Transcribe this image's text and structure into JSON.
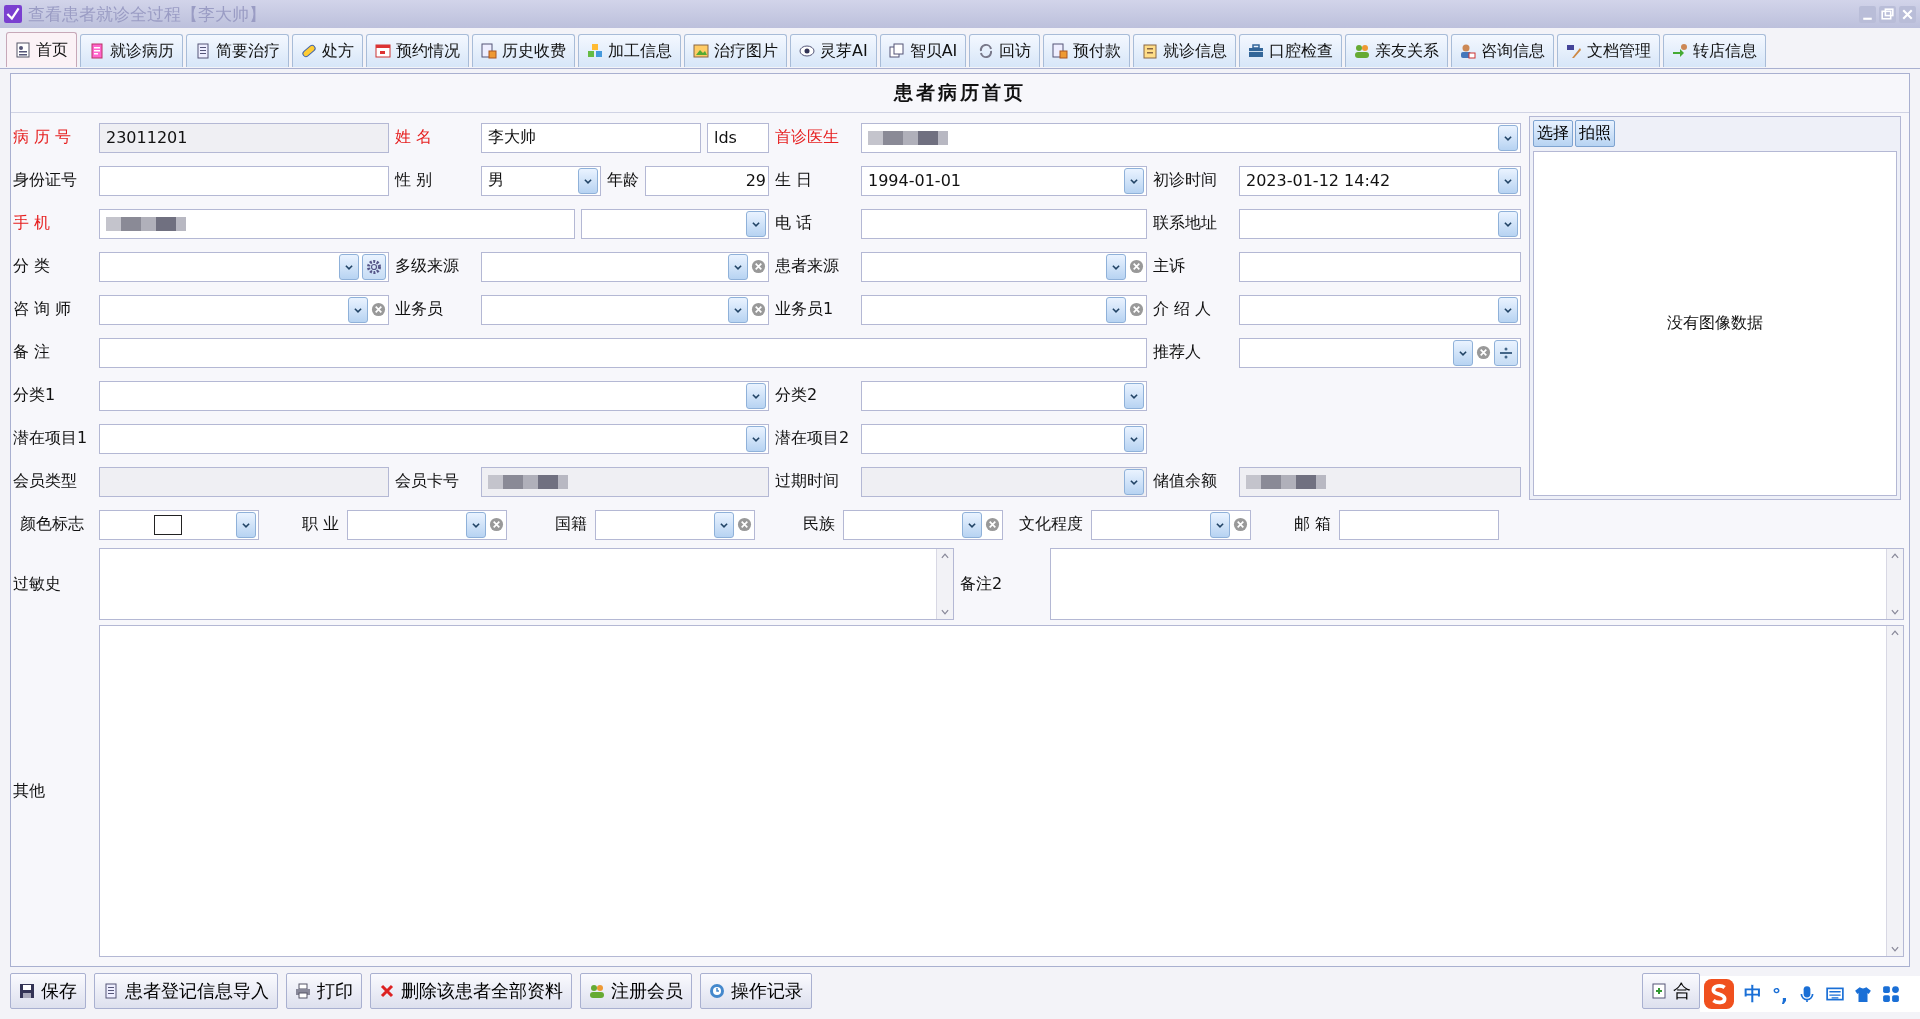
{
  "window": {
    "title": "查看患者就诊全过程【李大帅】"
  },
  "tabs": [
    {
      "label": "首页",
      "selected": true
    },
    {
      "label": "就诊病历",
      "selected": false
    },
    {
      "label": "简要治疗",
      "selected": false
    },
    {
      "label": "处方",
      "selected": false
    },
    {
      "label": "预约情况",
      "selected": false
    },
    {
      "label": "历史收费",
      "selected": false
    },
    {
      "label": "加工信息",
      "selected": false
    },
    {
      "label": "治疗图片",
      "selected": false
    },
    {
      "label": "灵芽AI",
      "selected": false
    },
    {
      "label": "智贝AI",
      "selected": false
    },
    {
      "label": "回访",
      "selected": false
    },
    {
      "label": "预付款",
      "selected": false
    },
    {
      "label": "就诊信息",
      "selected": false
    },
    {
      "label": "口腔检查",
      "selected": false
    },
    {
      "label": "亲友关系",
      "selected": false
    },
    {
      "label": "咨询信息",
      "selected": false
    },
    {
      "label": "文档管理",
      "selected": false
    },
    {
      "label": "转店信息",
      "selected": false
    }
  ],
  "form": {
    "title": "患者病历首页",
    "rows": [
      {
        "fields": [
          {
            "label": "病 历 号",
            "required": true,
            "inputs": [
              {
                "kind": "text",
                "value": "23011201",
                "disabled": true
              }
            ]
          },
          {
            "label": "姓 名",
            "required": true,
            "inputs": [
              {
                "kind": "text",
                "value": "李大帅",
                "disabled": false
              },
              {
                "kind": "text",
                "value": "lds",
                "disabled": false
              }
            ]
          },
          {
            "label": "首诊医生",
            "required": true,
            "inputs": [
              {
                "kind": "select",
                "disabled": false,
                "blurred": true
              }
            ]
          }
        ]
      },
      {
        "fields": [
          {
            "label": "身份证号",
            "required": false,
            "inputs": [
              {
                "kind": "text",
                "disabled": false
              }
            ]
          },
          {
            "label": "性 别",
            "required": false,
            "inputs": [
              {
                "kind": "select",
                "value": "男",
                "disabled": false
              },
              {
                "kind": "label",
                "text": "年龄"
              },
              {
                "kind": "text",
                "value": "29",
                "disabled": false
              }
            ]
          },
          {
            "label": "生 日",
            "required": false,
            "inputs": [
              {
                "kind": "select",
                "value": "1994-01-01",
                "disabled": false
              }
            ]
          },
          {
            "label": "初诊时间",
            "required": false,
            "inputs": [
              {
                "kind": "select",
                "value": "2023-01-12 14:42",
                "disabled": false
              }
            ]
          }
        ]
      },
      {
        "fields": [
          {
            "label": "手 机",
            "required": true,
            "inputs": [
              {
                "kind": "text",
                "disabled": false,
                "blurred": true
              },
              {
                "kind": "select",
                "disabled": false
              }
            ]
          },
          {
            "label": "电 话",
            "required": false,
            "inputs": [
              {
                "kind": "text",
                "disabled": false
              }
            ]
          },
          {
            "label": "联系地址",
            "required": false,
            "inputs": [
              {
                "kind": "select",
                "disabled": false
              }
            ]
          }
        ]
      },
      {
        "fields": [
          {
            "label": "分 类",
            "required": false,
            "inputs": [
              {
                "kind": "select",
                "disabled": false,
                "gear": true
              }
            ]
          },
          {
            "label": "多级来源",
            "required": false,
            "inputs": [
              {
                "kind": "select",
                "disabled": false,
                "clear": true
              }
            ]
          },
          {
            "label": "患者来源",
            "required": false,
            "inputs": [
              {
                "kind": "select",
                "disabled": false,
                "clear": true
              }
            ]
          },
          {
            "label": "主诉",
            "required": false,
            "inputs": [
              {
                "kind": "text",
                "disabled": false
              }
            ]
          }
        ]
      },
      {
        "fields": [
          {
            "label": "咨 询 师",
            "required": false,
            "inputs": [
              {
                "kind": "select",
                "disabled": false,
                "clear": true
              }
            ]
          },
          {
            "label": "业务员",
            "required": false,
            "inputs": [
              {
                "kind": "select",
                "disabled": false,
                "clear": true
              }
            ]
          },
          {
            "label": "业务员1",
            "required": false,
            "inputs": [
              {
                "kind": "select",
                "disabled": false,
                "clear": true
              }
            ]
          },
          {
            "label": "介 绍 人",
            "required": false,
            "inputs": [
              {
                "kind": "select",
                "disabled": false
              }
            ]
          }
        ]
      },
      {
        "fields": [
          {
            "label": "备 注",
            "required": false,
            "inputs": [
              {
                "kind": "text",
                "disabled": false
              }
            ]
          },
          {
            "label": "推荐人",
            "required": false,
            "inputs": [
              {
                "kind": "select",
                "disabled": false,
                "clear": true,
                "add": true
              }
            ]
          }
        ]
      },
      {
        "fields": [
          {
            "label": "分类1",
            "required": false,
            "inputs": [
              {
                "kind": "select",
                "disabled": false
              }
            ]
          },
          {
            "label": "分类2",
            "required": false,
            "inputs": [
              {
                "kind": "select",
                "disabled": false
              }
            ]
          }
        ]
      },
      {
        "fields": [
          {
            "label": "潜在项目1",
            "required": false,
            "inputs": [
              {
                "kind": "select",
                "disabled": false
              }
            ]
          },
          {
            "label": "潜在项目2",
            "required": false,
            "inputs": [
              {
                "kind": "select",
                "disabled": false
              }
            ]
          }
        ]
      },
      {
        "fields": [
          {
            "label": "会员类型",
            "required": false,
            "inputs": [
              {
                "kind": "text",
                "disabled": true
              }
            ]
          },
          {
            "label": "会员卡号",
            "required": false,
            "inputs": [
              {
                "kind": "text",
                "disabled": true,
                "blurred": true
              }
            ]
          },
          {
            "label": "过期时间",
            "required": false,
            "inputs": [
              {
                "kind": "select",
                "disabled": true
              }
            ]
          },
          {
            "label": "储值余额",
            "required": false,
            "inputs": [
              {
                "kind": "text",
                "disabled": true,
                "blurred": true
              }
            ]
          }
        ]
      }
    ],
    "attributes": [
      {
        "label": "颜色标志",
        "required": false,
        "inputs": [
          {
            "kind": "color",
            "disabled": false
          }
        ]
      },
      {
        "label": "职 业",
        "required": false,
        "inputs": [
          {
            "kind": "select",
            "disabled": false,
            "clear": true
          }
        ]
      },
      {
        "label": "国籍",
        "required": false,
        "inputs": [
          {
            "kind": "select",
            "disabled": false,
            "clear": true
          }
        ]
      },
      {
        "label": "民族",
        "required": false,
        "inputs": [
          {
            "kind": "select",
            "disabled": false,
            "clear": true
          }
        ]
      },
      {
        "label": "文化程度",
        "required": false,
        "inputs": [
          {
            "kind": "select",
            "disabled": false,
            "clear": true
          }
        ]
      },
      {
        "label": "邮 箱",
        "required": false,
        "inputs": [
          {
            "kind": "text",
            "disabled": false
          }
        ]
      }
    ],
    "notes": [
      {
        "label": "过敏史",
        "required": false,
        "inputs": [
          {
            "kind": "textarea",
            "disabled": false
          }
        ]
      },
      {
        "label": "备注2",
        "required": false,
        "inputs": [
          {
            "kind": "textarea",
            "disabled": false
          }
        ]
      },
      {
        "label": "其他",
        "required": false,
        "inputs": [
          {
            "kind": "textarea",
            "disabled": false
          }
        ]
      }
    ]
  },
  "photo": {
    "buttons": [
      "选择",
      "拍照"
    ],
    "empty_text": "没有图像数据"
  },
  "toolbar": {
    "buttons": [
      "保存",
      "患者登记信息导入",
      "打印",
      "删除该患者全部资料",
      "注册会员",
      "操作记录"
    ],
    "right_buttons": [
      "合"
    ]
  },
  "ime_toolbar": {
    "mode": "中",
    "punctuation": "°,"
  }
}
